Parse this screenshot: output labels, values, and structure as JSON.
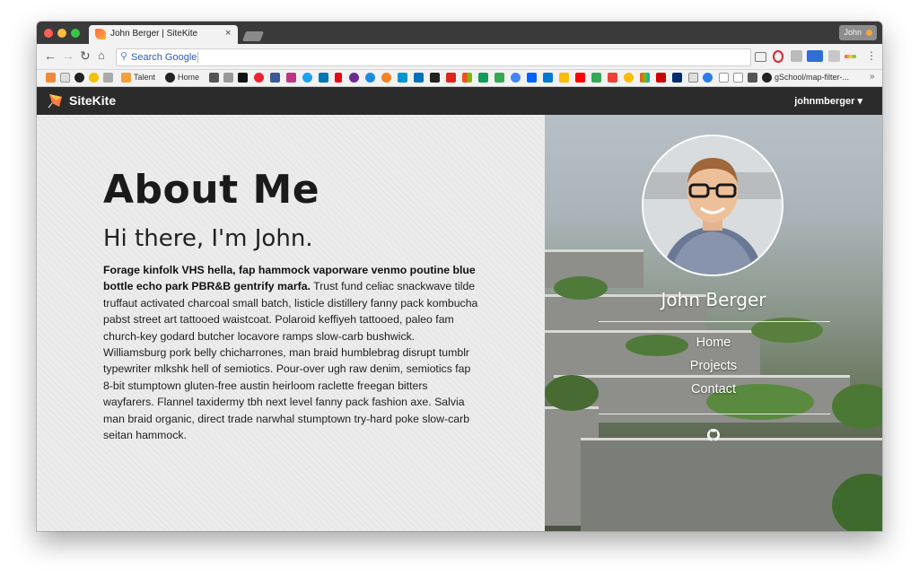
{
  "browser": {
    "tab_title": "John Berger | SiteKite",
    "tab_close": "×",
    "profile_label": "John",
    "omnibox_placeholder": "Search Google",
    "bookmarks": [
      {
        "label": "Talent"
      },
      {
        "label": "Home"
      },
      {
        "label": "gSchool/map-filter-..."
      }
    ],
    "more_label": "»"
  },
  "site": {
    "brand": "SiteKite",
    "user_menu": "johnmberger ▾"
  },
  "about": {
    "title": "About Me",
    "subtitle": "Hi there, I'm John.",
    "bio_lead": "Forage kinfolk VHS hella, fap hammock vaporware venmo poutine blue bottle echo park PBR&B gentrify marfa.",
    "bio_rest": " Trust fund celiac snackwave tilde truffaut activated charcoal small batch, listicle distillery fanny pack kombucha pabst street art tattooed waistcoat. Polaroid keffiyeh tattooed, paleo fam church-key godard butcher locavore ramps slow-carb bushwick. Williamsburg pork belly chicharrones, man braid humblebrag disrupt tumblr typewriter mlkshk hell of semiotics. Pour-over ugh raw denim, semiotics fap 8-bit stumptown gluten-free austin heirloom raclette freegan bitters wayfarers. Flannel taxidermy tbh next level fanny pack fashion axe. Salvia man braid organic, direct trade narwhal stumptown try-hard poke slow-carb seitan hammock."
  },
  "profile": {
    "name": "John Berger",
    "nav": [
      {
        "label": "Home"
      },
      {
        "label": "Projects"
      },
      {
        "label": "Contact"
      }
    ],
    "social_icon": "github-icon"
  }
}
